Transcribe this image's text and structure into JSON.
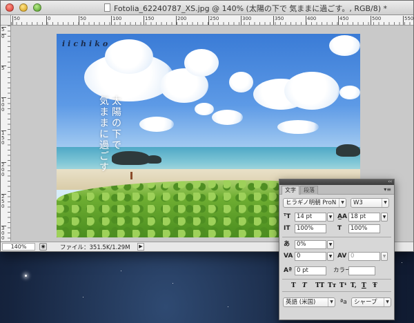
{
  "window": {
    "title": "Fotolia_62240787_XS.jpg @ 140% (太陽の下で 気ままに過ごす。, RGB/8) *"
  },
  "rulers": {
    "horizontal": [
      "50",
      "0",
      "50",
      "100",
      "150",
      "200",
      "250",
      "300",
      "350",
      "400",
      "450",
      "500",
      "550"
    ],
    "vertical": [
      "5",
      "0",
      "5",
      "100",
      "150",
      "200",
      "250",
      "300"
    ]
  },
  "image": {
    "signature": "iichiko",
    "text_col1": "太陽の下で",
    "text_col2": "気ままに過ごす"
  },
  "statusbar": {
    "zoom": "140%",
    "file_info": "ファイル：351.5K/1.29M",
    "arrow": "▶"
  },
  "panel": {
    "tab_character": "文字",
    "tab_paragraph": "段落",
    "font_family": "ヒラギノ明朝 ProN",
    "font_style": "W3",
    "font_size": "14 pt",
    "leading": "18 pt",
    "vertical_scale": "100%",
    "horizontal_scale": "100%",
    "tsume": "0%",
    "kerning": "0",
    "tracking": "0",
    "baseline_shift": "0 pt",
    "color_label": "カラー：",
    "language": "英語 (米国)",
    "aa_icon_text": "a",
    "antialias": "シャープ",
    "type_style_buttons": [
      "T",
      "T",
      "TT",
      "Tт",
      "T¹",
      "T,",
      "T",
      "Ŧ"
    ]
  }
}
